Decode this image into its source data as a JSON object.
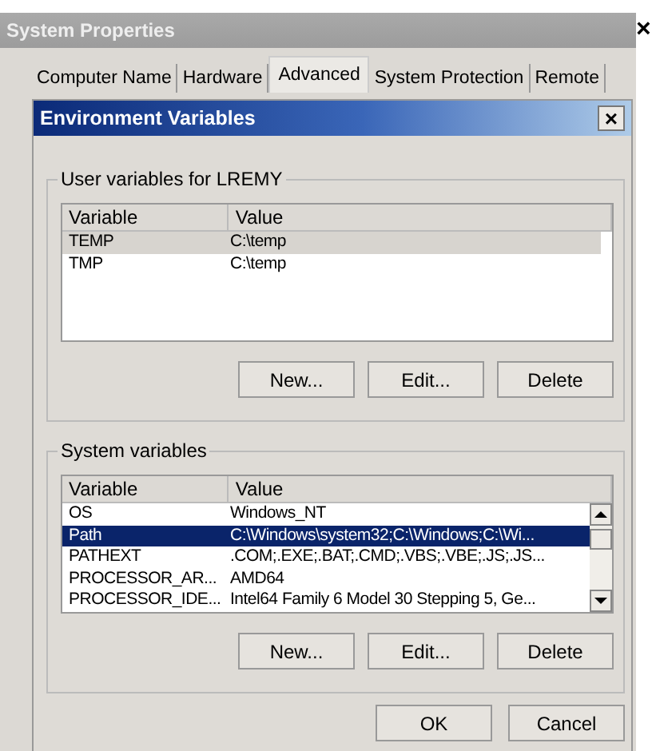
{
  "window": {
    "title": "System Properties",
    "close": "×"
  },
  "tabs": [
    {
      "label": "Computer Name",
      "selected": false
    },
    {
      "label": "Hardware",
      "selected": false
    },
    {
      "label": "Advanced",
      "selected": true
    },
    {
      "label": "System Protection",
      "selected": false
    },
    {
      "label": "Remote",
      "selected": false
    }
  ],
  "dialog": {
    "title": "Environment Variables",
    "close": "×"
  },
  "groups": [
    {
      "title": "User variables for LREMY",
      "focused": false,
      "scrollbar": false,
      "columns": [
        "Variable",
        "Value"
      ],
      "rows": [
        {
          "cells": [
            "TEMP",
            "C:\\temp"
          ],
          "selected": true
        },
        {
          "cells": [
            "TMP",
            "C:\\temp"
          ],
          "selected": false
        }
      ],
      "buttons": [
        "New...",
        "Edit...",
        "Delete"
      ]
    },
    {
      "title": "System variables",
      "focused": true,
      "scrollbar": true,
      "columns": [
        "Variable",
        "Value"
      ],
      "rows": [
        {
          "cells": [
            "OS",
            "Windows_NT"
          ],
          "selected": false
        },
        {
          "cells": [
            "Path",
            "C:\\Windows\\system32;C:\\Windows;C:\\Wi..."
          ],
          "selected": true
        },
        {
          "cells": [
            "PATHEXT",
            ".COM;.EXE;.BAT;.CMD;.VBS;.VBE;.JS;.JS..."
          ],
          "selected": false
        },
        {
          "cells": [
            "PROCESSOR_AR...",
            "AMD64"
          ],
          "selected": false
        },
        {
          "cells": [
            "PROCESSOR_IDE...",
            "Intel64 Family 6 Model 30 Stepping 5, Ge..."
          ],
          "selected": false
        }
      ],
      "buttons": [
        "New...",
        "Edit...",
        "Delete"
      ]
    }
  ],
  "footer_buttons": [
    "OK",
    "Cancel"
  ]
}
